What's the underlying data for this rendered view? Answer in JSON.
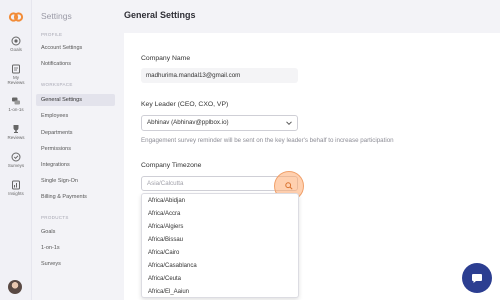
{
  "rail": {
    "items": [
      {
        "label": "Goals",
        "icon": "target-icon"
      },
      {
        "label": "My Reviews",
        "icon": "reviews-icon"
      },
      {
        "label": "1-on-1s",
        "icon": "chat-bubbles-icon"
      },
      {
        "label": "Reviews",
        "icon": "trophy-icon"
      },
      {
        "label": "Surveys",
        "icon": "survey-icon"
      },
      {
        "label": "Insights",
        "icon": "insights-icon"
      }
    ]
  },
  "nav": {
    "title": "Settings",
    "section_profile": "PROFILE",
    "section_workspace": "WORKSPACE",
    "section_products": "PRODUCTS",
    "profile_items": [
      "Account Settings",
      "Notifications"
    ],
    "workspace_items": [
      "General Settings",
      "Employees",
      "Departments",
      "Permissions",
      "Integrations",
      "Single Sign-On",
      "Billing & Payments"
    ],
    "product_items": [
      "Goals",
      "1-on-1s",
      "Surveys"
    ]
  },
  "main": {
    "title": "General Settings",
    "company_name_label": "Company Name",
    "company_name_value": "madhurima.mandal13@gmail.com",
    "key_leader_label": "Key Leader (CEO, CXO, VP)",
    "key_leader_value": "Abhinav (Abhinav@pplbox.io)",
    "key_leader_hint": "Engagement survey reminder will be sent on the key leader's behalf to increase participation",
    "timezone_label": "Company Timezone",
    "timezone_placeholder": "Asia/Calcutta",
    "timezone_options": [
      "Africa/Abidjan",
      "Africa/Accra",
      "Africa/Algiers",
      "Africa/Bissau",
      "Africa/Cairo",
      "Africa/Casablanca",
      "Africa/Ceuta",
      "Africa/El_Aaiun"
    ]
  },
  "colors": {
    "accent_orange": "#f0a06a",
    "chat_button": "#2c3e91",
    "logo": "#f28c38"
  }
}
